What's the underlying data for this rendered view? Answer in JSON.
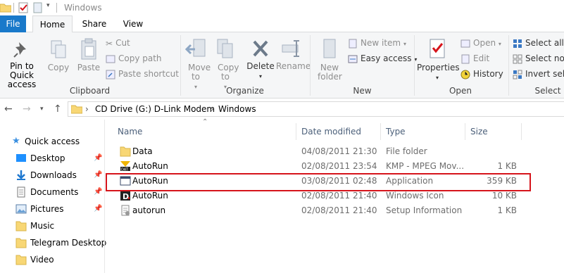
{
  "window": {
    "title": "Windows"
  },
  "tabs": {
    "file": "File",
    "home": "Home",
    "share": "Share",
    "view": "View"
  },
  "ribbon": {
    "clipboard": {
      "pin": "Pin to Quick access",
      "copy": "Copy",
      "paste": "Paste",
      "cut": "Cut",
      "copy_path": "Copy path",
      "paste_shortcut": "Paste shortcut",
      "group": "Clipboard"
    },
    "organize": {
      "move_to": "Move to",
      "copy_to": "Copy to",
      "delete": "Delete",
      "rename": "Rename",
      "group": "Organize"
    },
    "new": {
      "new_folder": "New folder",
      "new_item": "New item",
      "easy_access": "Easy access",
      "group": "New"
    },
    "open": {
      "properties": "Properties",
      "open": "Open",
      "edit": "Edit",
      "history": "History",
      "group": "Open"
    },
    "select": {
      "select_all": "Select all",
      "select_none": "Select none",
      "invert_selection": "Invert selection",
      "group": "Select"
    }
  },
  "address": {
    "crumbs": [
      "CD Drive (G:) D-Link Modem",
      "Windows"
    ]
  },
  "nav": {
    "items": [
      {
        "label": "Quick access",
        "icon": "star-icon"
      },
      {
        "label": "Desktop",
        "icon": "desktop-folder-icon",
        "pinned": true
      },
      {
        "label": "Downloads",
        "icon": "downloads-folder-icon",
        "pinned": true
      },
      {
        "label": "Documents",
        "icon": "documents-folder-icon",
        "pinned": true
      },
      {
        "label": "Pictures",
        "icon": "pictures-folder-icon",
        "pinned": true
      },
      {
        "label": "Music",
        "icon": "folder-icon"
      },
      {
        "label": "Telegram Desktop",
        "icon": "folder-icon"
      },
      {
        "label": "Video",
        "icon": "folder-icon"
      }
    ]
  },
  "columns": {
    "name": "Name",
    "date": "Date modified",
    "type": "Type",
    "size": "Size"
  },
  "files": [
    {
      "name": "Data",
      "date": "04/08/2011 21:30",
      "type": "File folder",
      "size": "",
      "icon": "folder-icon"
    },
    {
      "name": "AutoRun",
      "date": "02/08/2011 23:54",
      "type": "KMP - MPEG Mov...",
      "size": "1 KB",
      "icon": "dat-file-icon"
    },
    {
      "name": "AutoRun",
      "date": "03/08/2011 02:48",
      "type": "Application",
      "size": "359 KB",
      "icon": "application-icon"
    },
    {
      "name": "AutoRun",
      "date": "02/08/2011 21:40",
      "type": "Windows Icon",
      "size": "10 KB",
      "icon": "dlink-icon-file-icon"
    },
    {
      "name": "autorun",
      "date": "02/08/2011 21:40",
      "type": "Setup Information",
      "size": "1 KB",
      "icon": "setup-info-icon"
    }
  ],
  "colors": {
    "accent": "#1979ca",
    "highlight_border": "#d6141b",
    "folder": "#f8d775"
  }
}
